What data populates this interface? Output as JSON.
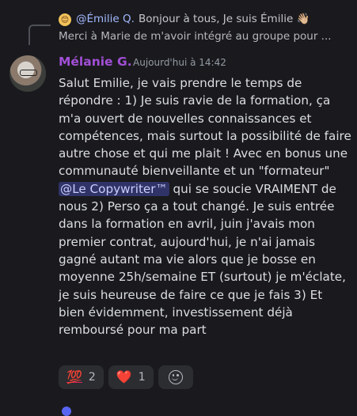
{
  "reply": {
    "author": "@Émilie Q.",
    "snippet": "Bonjour à tous,  Je suis Émilie 👋🏼",
    "snippet_line2": "Merci à Marie de m'avoir intégré au groupe pour ..."
  },
  "message": {
    "author": "Mélanie G.",
    "timestamp": "Aujourd'hui à 14:42",
    "text_before": "Salut Emilie, je vais prendre le temps de répondre : 1) Je suis ravie de la formation, ça m'a ouvert de nouvelles connaissances et compétences, mais surtout la possibilité de faire autre chose et qui me plait ! Avec en bonus une communauté bienveillante et un \"formateur\" ",
    "mention": "@Le Copywriter™",
    "text_after": " qui se soucie VRAIMENT de nous 2) Perso ça a tout changé. Je suis entrée dans la formation en avril, juin j'avais mon premier contrat, aujourd'hui, je n'ai jamais gagné autant ma vie alors que je bosse en moyenne 25h/semaine ET (surtout) je m'éclate, je suis heureuse de faire ce que je fais 3) Et bien évidemment, investissement déjà remboursé pour ma part"
  },
  "reactions": [
    {
      "emoji": "💯",
      "icon": "hundred-points-icon",
      "count": "2"
    },
    {
      "emoji": "❤️",
      "icon": "red-heart-icon",
      "count": "1"
    }
  ],
  "colors": {
    "background": "#1a1a1e",
    "author": "#a24fd6",
    "mention_bg": "#3c4282",
    "reply_author": "#a3b8ff"
  }
}
